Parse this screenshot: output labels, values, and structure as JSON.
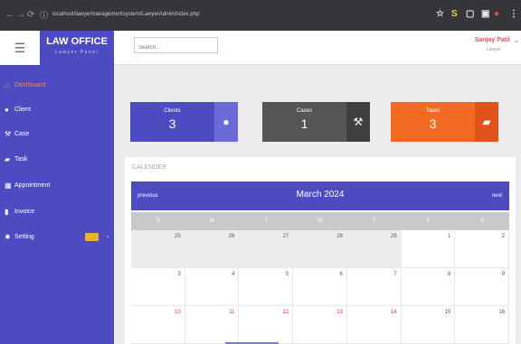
{
  "browser": {
    "url": "localhost/lawyermanagementsystem/LawyerAdmin/index.php"
  },
  "app": {
    "brand_title": "LAW OFFICE",
    "brand_subtitle": "Lawyer Panel"
  },
  "sidebar": {
    "items": [
      {
        "label": "Dashboard",
        "icon": "home-icon"
      },
      {
        "label": "Client",
        "icon": "user-icon"
      },
      {
        "label": "Case",
        "icon": "gavel-icon"
      },
      {
        "label": "Task",
        "icon": "book-icon"
      },
      {
        "label": "Appointment",
        "icon": "calendar-icon"
      },
      {
        "label": "Invoice",
        "icon": "file-icon"
      },
      {
        "label": "Setting",
        "icon": "gear-icon",
        "badge": ""
      }
    ]
  },
  "topbar": {
    "search_placeholder": "Search...",
    "user_name": "Sanjay Patil",
    "user_role": "Lawyer"
  },
  "cards": [
    {
      "label": "Clients",
      "value": "3",
      "color": "#4c4bc1",
      "icon_bg": "#6b6ad6"
    },
    {
      "label": "Cases",
      "value": "1",
      "color": "#555555",
      "icon_bg": "#3f3f3f"
    },
    {
      "label": "Tasks",
      "value": "3",
      "color": "#f26a21",
      "icon_bg": "#e2521b"
    }
  ],
  "calendar": {
    "title": "CALENDER",
    "prev": "previous",
    "next": "next",
    "month": "March 2024",
    "days": [
      "S",
      "M",
      "T",
      "W",
      "T",
      "F",
      "S"
    ],
    "weeks": [
      [
        "25",
        "26",
        "27",
        "28",
        "29",
        "1",
        "2"
      ],
      [
        "3",
        "4",
        "5",
        "6",
        "7",
        "8",
        "9"
      ],
      [
        "10",
        "11",
        "12",
        "13",
        "14",
        "15",
        "16"
      ]
    ]
  }
}
